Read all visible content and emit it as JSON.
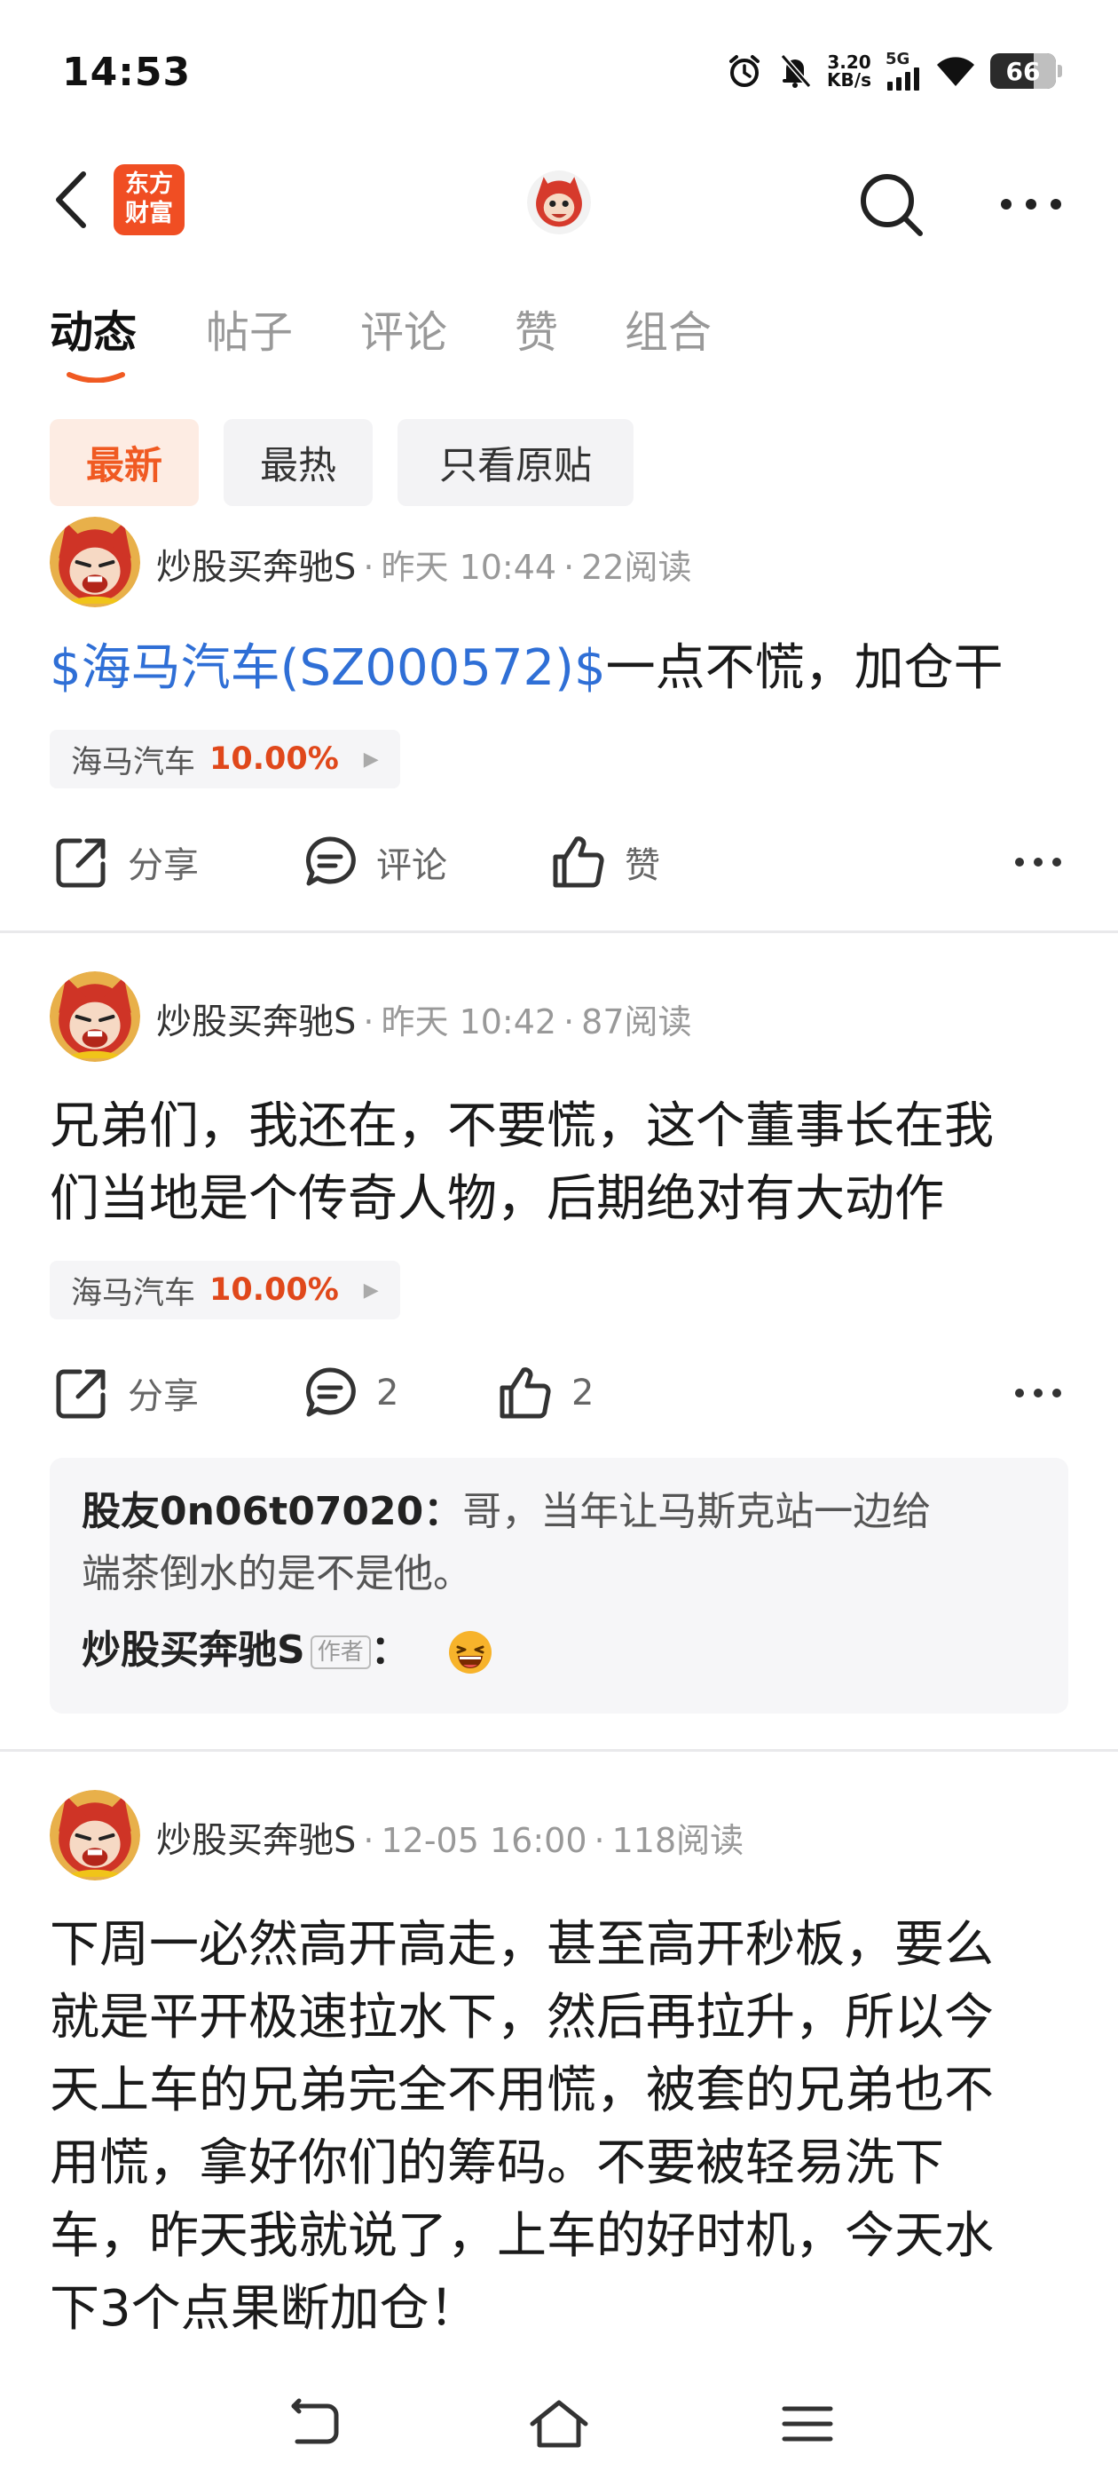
{
  "status_bar": {
    "time": "14:53",
    "net_speed_value": "3.20",
    "net_speed_unit": "KB/s",
    "network": "5G",
    "battery": "66"
  },
  "header": {
    "brand_line1": "东方",
    "brand_line2": "财富"
  },
  "tabs": [
    "动态",
    "帖子",
    "评论",
    "赞",
    "组合"
  ],
  "filters": [
    "最新",
    "最热",
    "只看原贴"
  ],
  "colors": {
    "accent": "#f05a22",
    "link": "#2f6fd6",
    "gain": "#e0481b"
  },
  "posts": [
    {
      "author": "炒股买奔驰S",
      "time": "昨天 10:44",
      "reads": "22阅读",
      "stock_link": "$海马汽车(SZ000572)$",
      "text": "一点不慌，加仓干",
      "tag_name": "海马汽车",
      "tag_pct": "10.00%",
      "share": "分享",
      "comment": "评论",
      "like": "赞"
    },
    {
      "author": "炒股买奔驰S",
      "time": "昨天 10:42",
      "reads": "87阅读",
      "text_line1": "兄弟们，我还在，不要慌，这个董事长在我",
      "text_line2": "们当地是个传奇人物，后期绝对有大动作",
      "tag_name": "海马汽车",
      "tag_pct": "10.00%",
      "share": "分享",
      "comment": "2",
      "like": "2",
      "comments": [
        {
          "author": "股友0n06t07020",
          "sep": "：",
          "text_line1": "哥，当年让马斯克站一边给",
          "text_line2": "端茶倒水的是不是他。"
        },
        {
          "author": "炒股买奔驰S",
          "badge": "作者",
          "sep": "：",
          "emoji": "laughing-emoji"
        }
      ]
    },
    {
      "author": "炒股买奔驰S",
      "time": "12-05 16:00",
      "reads": "118阅读",
      "text_lines": [
        "下周一必然高开高走，甚至高开秒板，要么",
        "就是平开极速拉水下，然后再拉升，所以今",
        "天上车的兄弟完全不用慌，被套的兄弟也不",
        "用慌，拿好你们的筹码。不要被轻易洗下",
        "车，昨天我就说了，上车的好时机，今天水",
        "下3个点果断加仓！"
      ]
    }
  ],
  "dot": "·"
}
